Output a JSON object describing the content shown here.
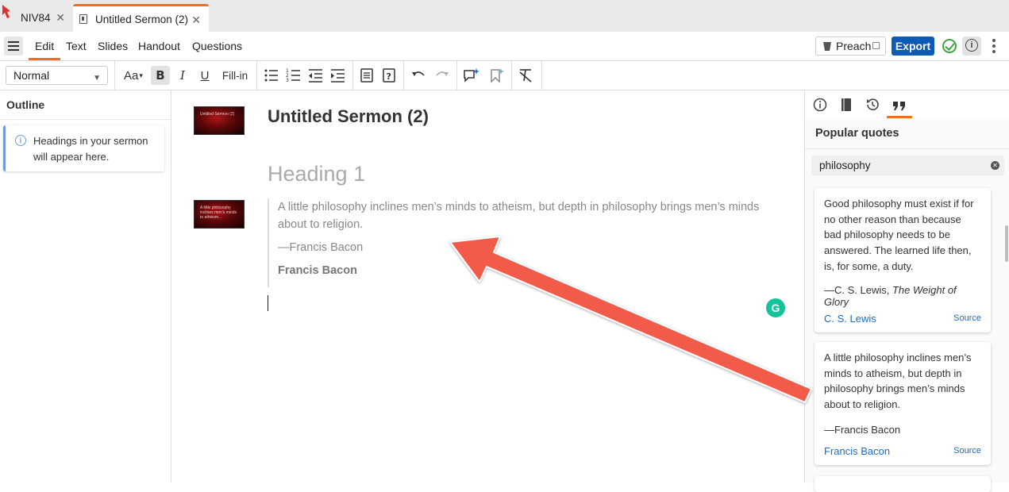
{
  "tabs": [
    {
      "label": "NIV84"
    },
    {
      "label": "Untitled Sermon (2)"
    }
  ],
  "menu": {
    "items": [
      "Edit",
      "Text",
      "Slides",
      "Handout",
      "Questions"
    ],
    "active": "Edit",
    "preach_label": "Preach",
    "export_label": "Export"
  },
  "toolbar": {
    "style_value": "Normal",
    "fillin_label": "Fill-in",
    "font_size_glyph": "Aa",
    "bold_glyph": "B",
    "italic_glyph": "I",
    "underline_glyph": "U"
  },
  "outline": {
    "title": "Outline",
    "note": "Headings in your sermon will appear here."
  },
  "editor": {
    "sermon_title": "Untitled Sermon (2)",
    "heading": "Heading 1",
    "quote_text": "A little philosophy inclines men’s minds to atheism, but depth in philosophy brings men’s minds about to religion.",
    "quote_attribution": "—Francis Bacon",
    "quote_author": "Francis Bacon",
    "thumb1_text": "Untitled Sermon (2)",
    "thumb2_text": "A little philosophy inclines men’s minds to atheism..."
  },
  "quotes_panel": {
    "title": "Popular quotes",
    "search_value": "philosophy",
    "quotes": [
      {
        "text": "Good philosophy must exist if for no other reason than because bad philosophy needs to be answered. The learned life then, is, for some, a duty.",
        "attribution_prefix": "—C. S. Lewis, ",
        "attribution_work": "The Weight of Glory",
        "author": "C. S. Lewis",
        "source_label": "Source"
      },
      {
        "text": "A little philosophy inclines men’s minds to atheism, but depth in philosophy brings men’s minds about to religion.",
        "attribution_prefix": "—Francis Bacon",
        "attribution_work": "",
        "author": "Francis Bacon",
        "source_label": "Source"
      }
    ]
  },
  "colors": {
    "accent": "#e8702a",
    "export_blue": "#0d5bb5",
    "link_blue": "#1a6fc4",
    "annotation_arrow": "#f25a4a",
    "grammarly": "#15c39a"
  },
  "icons": [
    "logos-icon",
    "document-icon",
    "close-icon",
    "menu-icon",
    "pulpit-icon",
    "external-link-icon",
    "check-circle-icon",
    "info-icon",
    "more-vert-icon",
    "bullet-list-icon",
    "numbered-list-icon",
    "outdent-icon",
    "indent-icon",
    "block-icon",
    "question-icon",
    "undo-icon",
    "redo-icon",
    "comment-icon",
    "bookmark-icon",
    "clear-format-icon",
    "library-icon",
    "history-icon",
    "quote-icon",
    "grammarly-icon"
  ]
}
